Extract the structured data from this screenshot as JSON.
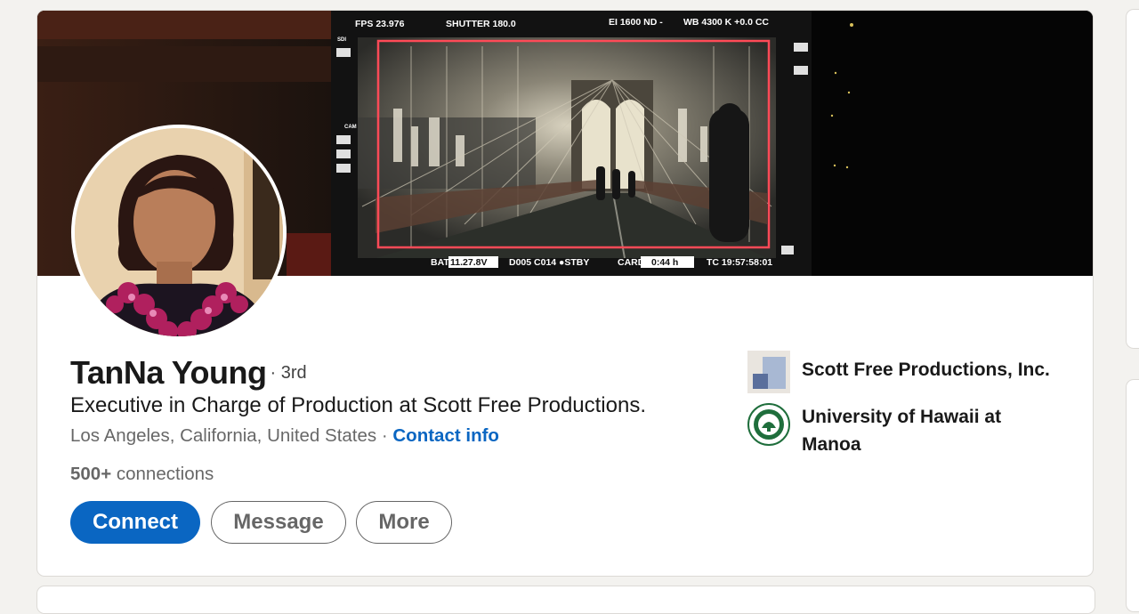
{
  "profile": {
    "name": "TanNa Young",
    "degree": "· 3rd",
    "headline": "Executive in Charge of Production at Scott Free Productions.",
    "location": "Los Angeles, California, United States",
    "location_separator": " · ",
    "contact_link": "Contact info",
    "connections_count": "500+",
    "connections_label": " connections"
  },
  "actions": {
    "connect": "Connect",
    "message": "Message",
    "more": "More"
  },
  "orgs": [
    {
      "name": "Scott Free Productions, Inc.",
      "icon": "company-logo"
    },
    {
      "name": "University of Hawaii at Manoa",
      "icon": "university-seal"
    }
  ],
  "banner": {
    "fps": "FPS 23.976",
    "shutter": "SHUTTER 180.0",
    "ei": "EI 1600 ND -",
    "wb": "WB  4300 K  +0.0 CC",
    "bat": "BAT",
    "bat_val": "11.27.8V",
    "clip": "D005  C014  ●STBY",
    "card": "CARD",
    "card_val": "0:44 h",
    "tc": "TC 19:57:58:01",
    "side_labels": [
      "SDI",
      "CAM"
    ]
  },
  "colors": {
    "accent": "#0a66c2",
    "page_bg": "#f3f2ef",
    "frame_guide": "#ff4a57",
    "seal_green": "#1f6e3c"
  }
}
